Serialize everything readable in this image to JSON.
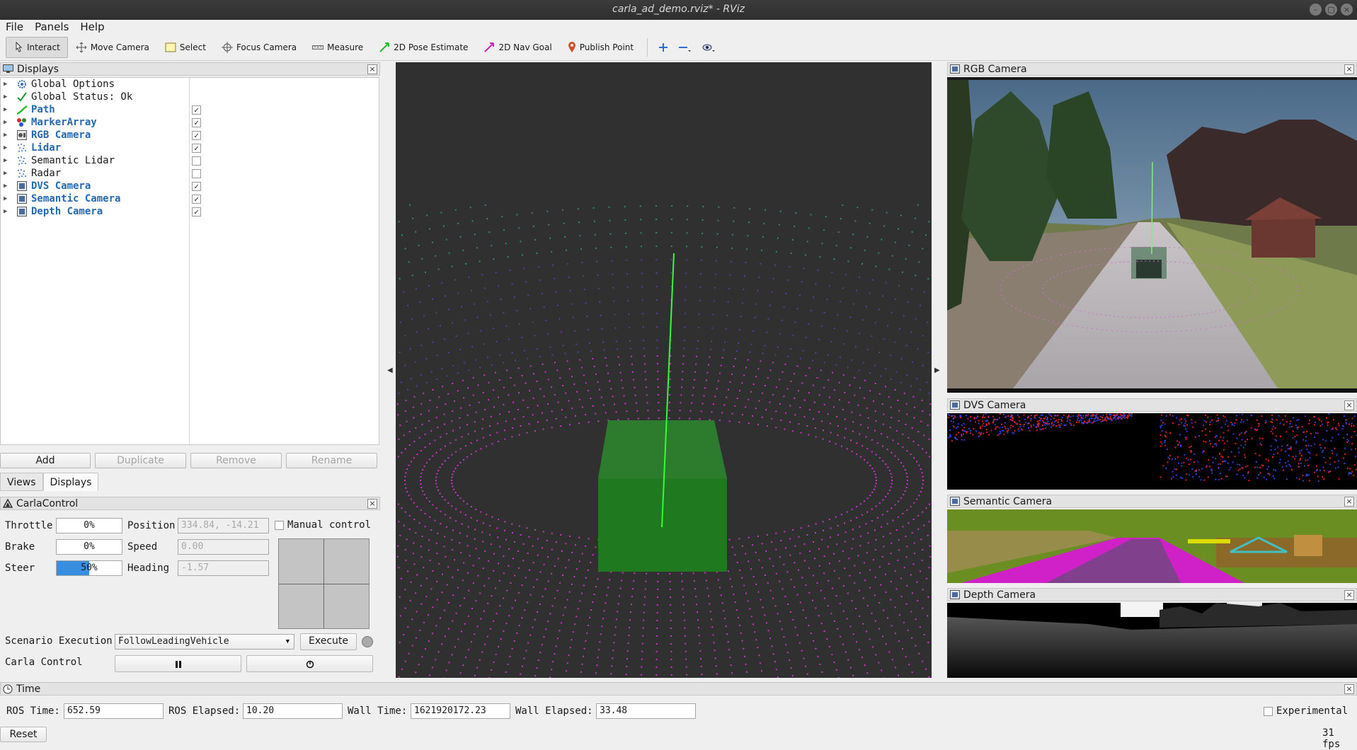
{
  "window": {
    "title": "carla_ad_demo.rviz* - RViz"
  },
  "menu": [
    "File",
    "Panels",
    "Help"
  ],
  "toolbar": {
    "tools": [
      {
        "label": "Interact",
        "icon": "cursor-icon",
        "active": true
      },
      {
        "label": "Move Camera",
        "icon": "move-arrows-icon",
        "active": false
      },
      {
        "label": "Select",
        "icon": "select-rect-icon",
        "active": false
      },
      {
        "label": "Focus Camera",
        "icon": "focus-crosshair-icon",
        "active": false
      },
      {
        "label": "Measure",
        "icon": "ruler-icon",
        "active": false
      },
      {
        "label": "2D Pose Estimate",
        "icon": "green-arrow-icon",
        "active": false
      },
      {
        "label": "2D Nav Goal",
        "icon": "magenta-arrow-icon",
        "active": false
      },
      {
        "label": "Publish Point",
        "icon": "map-pin-icon",
        "active": false
      }
    ],
    "extra_icons": [
      "add-tool-icon",
      "remove-tool-icon",
      "view-options-icon"
    ]
  },
  "displays_panel": {
    "title": "Displays",
    "items": [
      {
        "label": "Global Options",
        "icon": "gear-icon",
        "checkbox": null,
        "enabled": false
      },
      {
        "label": "Global Status: Ok",
        "icon": "checkmark-icon",
        "checkbox": null,
        "enabled": false
      },
      {
        "label": "Path",
        "icon": "path-icon",
        "checkbox": true,
        "enabled": true
      },
      {
        "label": "MarkerArray",
        "icon": "marker-array-icon",
        "checkbox": true,
        "enabled": true
      },
      {
        "label": "RGB Camera",
        "icon": "camera-icon",
        "checkbox": true,
        "enabled": true
      },
      {
        "label": "Lidar",
        "icon": "pointcloud-icon",
        "checkbox": true,
        "enabled": true
      },
      {
        "label": "Semantic Lidar",
        "icon": "pointcloud-icon",
        "checkbox": false,
        "enabled": false
      },
      {
        "label": "Radar",
        "icon": "pointcloud-icon",
        "checkbox": false,
        "enabled": false
      },
      {
        "label": "DVS Camera",
        "icon": "image-icon",
        "checkbox": true,
        "enabled": true
      },
      {
        "label": "Semantic Camera",
        "icon": "image-icon",
        "checkbox": true,
        "enabled": true
      },
      {
        "label": "Depth Camera",
        "icon": "image-icon",
        "checkbox": true,
        "enabled": true
      }
    ],
    "buttons": {
      "add": "Add",
      "duplicate": "Duplicate",
      "remove": "Remove",
      "rename": "Rename"
    }
  },
  "tabs": {
    "views": "Views",
    "displays": "Displays"
  },
  "carla_control": {
    "title": "CarlaControl",
    "throttle_label": "Throttle",
    "throttle_value": "0%",
    "throttle_fraction": 0,
    "brake_label": "Brake",
    "brake_value": "0%",
    "brake_fraction": 0,
    "steer_label": "Steer",
    "steer_value": "50%",
    "steer_fraction": 0.5,
    "position_label": "Position",
    "position_value": "334.84, -14.21",
    "speed_label": "Speed",
    "speed_value": "0.00",
    "heading_label": "Heading",
    "heading_value": "-1.57",
    "manual_control_label": "Manual control",
    "scenario_label": "Scenario Execution",
    "scenario_selected": "FollowLeadingVehicle",
    "execute_label": "Execute",
    "carla_control_label": "Carla Control",
    "pause_icon": "pause-icon",
    "step_icon": "step-icon"
  },
  "camera_panels": [
    {
      "title": "RGB Camera"
    },
    {
      "title": "DVS Camera"
    },
    {
      "title": "Semantic Camera"
    },
    {
      "title": "Depth Camera"
    }
  ],
  "time_panel": {
    "title": "Time",
    "ros_time_label": "ROS Time:",
    "ros_time": "652.59",
    "ros_elapsed_label": "ROS Elapsed:",
    "ros_elapsed": "10.20",
    "wall_time_label": "Wall Time:",
    "wall_time": "1621920172.23",
    "wall_elapsed_label": "Wall Elapsed:",
    "wall_elapsed": "33.48",
    "experimental_label": "Experimental",
    "reset_label": "Reset",
    "fps": "31 fps"
  },
  "colors": {
    "enabled_item": "#2468b0",
    "viewport_bg": "#303030",
    "lidar": "#d43ad4",
    "path": "#33dd33",
    "marker": "#2e8b2e"
  }
}
